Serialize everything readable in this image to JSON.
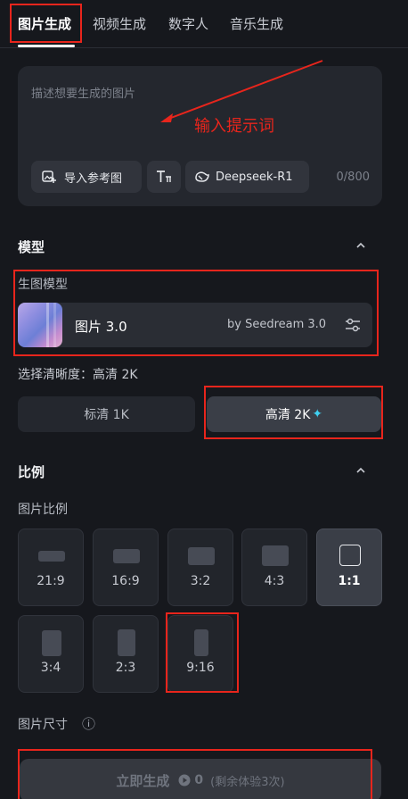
{
  "tabs": [
    {
      "label": "图片生成",
      "active": true
    },
    {
      "label": "视频生成"
    },
    {
      "label": "数字人"
    },
    {
      "label": "音乐生成"
    }
  ],
  "prompt": {
    "placeholder": "描述想要生成的图片",
    "annotation": "输入提示词",
    "ref_image_label": "导入参考图",
    "text_tool_icon": "text-tool-icon",
    "deepseek_label": "Deepseek-R1",
    "counter": "0/800"
  },
  "model": {
    "section_title": "模型",
    "sub_label": "生图模型",
    "name": "图片 3.0",
    "by": "by Seedream 3.0"
  },
  "quality": {
    "current": "选择清晰度：高清 2K",
    "standard": "标清 1K",
    "hd": "高清 2K",
    "hd_icon": "✦"
  },
  "ratio": {
    "section_title": "比例",
    "sub_label": "图片比例",
    "options": [
      "21:9",
      "16:9",
      "3:2",
      "4:3",
      "1:1",
      "3:4",
      "2:3",
      "9:16"
    ],
    "selected": "1:1"
  },
  "size": {
    "label": "图片尺寸",
    "info_icon": "ⓘ"
  },
  "generate": {
    "label": "立即生成",
    "count": "0",
    "note": "(剩余体验3次)"
  },
  "colors": {
    "background": "#16181d",
    "panel": "#24272e",
    "annotation": "#e8251c",
    "sparkle": "#3fd0f0"
  }
}
